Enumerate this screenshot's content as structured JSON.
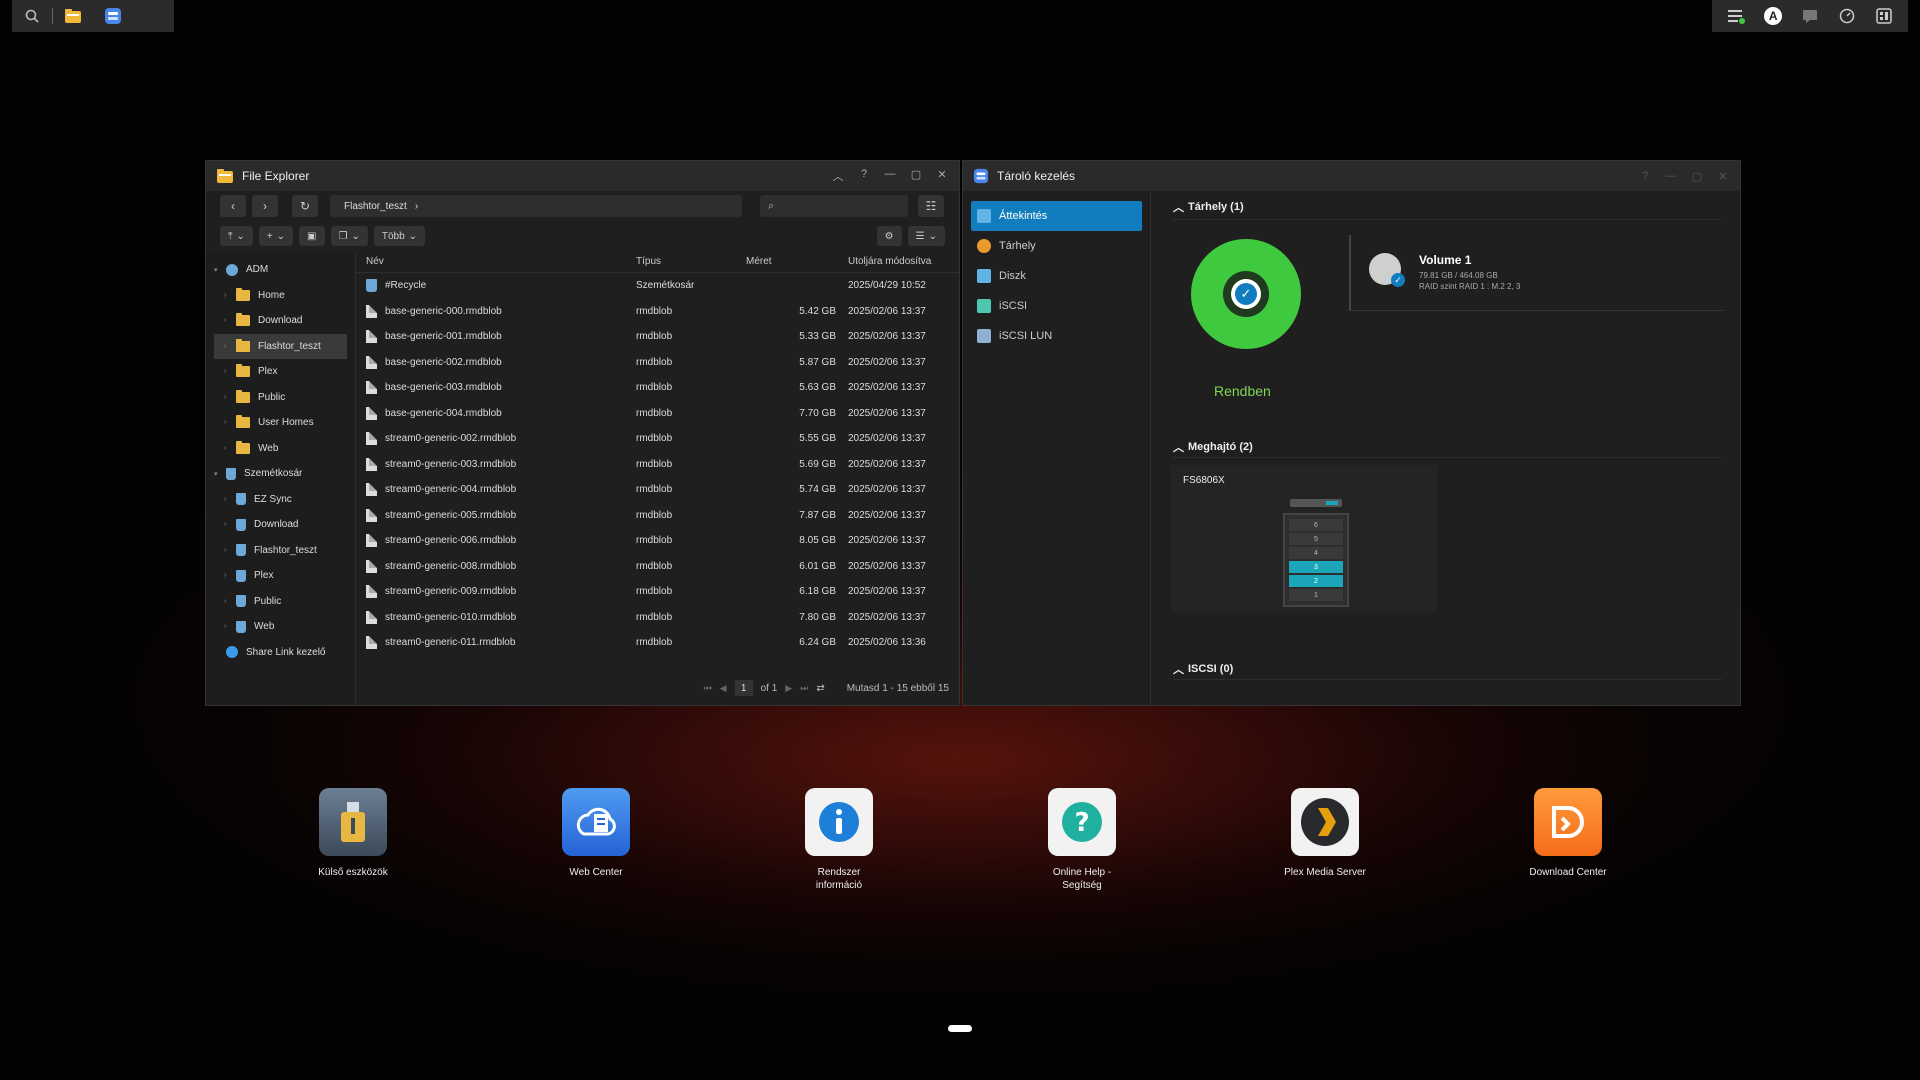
{
  "colors": {
    "accent": "#117dbe",
    "ok_green": "#3ec93e",
    "folder": "#e8b741",
    "bay_used": "#1aa6b8"
  },
  "file_explorer": {
    "title": "File Explorer",
    "path": "Flashtor_teszt",
    "more_label": "Több",
    "columns": {
      "name": "Név",
      "type": "Típus",
      "size": "Méret",
      "modified": "Utoljára módosítva"
    },
    "tree": [
      {
        "label": "ADM",
        "level": 0,
        "icon": "disk-icon"
      },
      {
        "label": "Home",
        "level": 1,
        "icon": "folder-icon"
      },
      {
        "label": "Download",
        "level": 1,
        "icon": "folder-icon"
      },
      {
        "label": "Flashtor_teszt",
        "level": 1,
        "icon": "folder-icon",
        "selected": true
      },
      {
        "label": "Plex",
        "level": 1,
        "icon": "folder-icon"
      },
      {
        "label": "Public",
        "level": 1,
        "icon": "folder-icon"
      },
      {
        "label": "User Homes",
        "level": 1,
        "icon": "folder-icon"
      },
      {
        "label": "Web",
        "level": 1,
        "icon": "folder-icon"
      },
      {
        "label": "Szemétkosár",
        "level": 0,
        "icon": "recycle-bin-icon"
      },
      {
        "label": "EZ Sync",
        "level": 1,
        "icon": "recycle-bin-icon"
      },
      {
        "label": "Download",
        "level": 1,
        "icon": "recycle-bin-icon"
      },
      {
        "label": "Flashtor_teszt",
        "level": 1,
        "icon": "recycle-bin-icon"
      },
      {
        "label": "Plex",
        "level": 1,
        "icon": "recycle-bin-icon"
      },
      {
        "label": "Public",
        "level": 1,
        "icon": "recycle-bin-icon"
      },
      {
        "label": "Web",
        "level": 1,
        "icon": "recycle-bin-icon"
      },
      {
        "label": "Share Link kezelő",
        "level": 0,
        "icon": "share-link-icon"
      }
    ],
    "files": [
      {
        "name": "#Recycle",
        "type": "Szemétkosár",
        "size": "",
        "modified": "2025/04/29 10:52"
      },
      {
        "name": "base-generic-000.rmdblob",
        "type": "rmdblob",
        "size": "5.42 GB",
        "modified": "2025/02/06 13:37"
      },
      {
        "name": "base-generic-001.rmdblob",
        "type": "rmdblob",
        "size": "5.33 GB",
        "modified": "2025/02/06 13:37"
      },
      {
        "name": "base-generic-002.rmdblob",
        "type": "rmdblob",
        "size": "5.87 GB",
        "modified": "2025/02/06 13:37"
      },
      {
        "name": "base-generic-003.rmdblob",
        "type": "rmdblob",
        "size": "5.63 GB",
        "modified": "2025/02/06 13:37"
      },
      {
        "name": "base-generic-004.rmdblob",
        "type": "rmdblob",
        "size": "7.70 GB",
        "modified": "2025/02/06 13:37"
      },
      {
        "name": "stream0-generic-002.rmdblob",
        "type": "rmdblob",
        "size": "5.55 GB",
        "modified": "2025/02/06 13:37"
      },
      {
        "name": "stream0-generic-003.rmdblob",
        "type": "rmdblob",
        "size": "5.69 GB",
        "modified": "2025/02/06 13:37"
      },
      {
        "name": "stream0-generic-004.rmdblob",
        "type": "rmdblob",
        "size": "5.74 GB",
        "modified": "2025/02/06 13:37"
      },
      {
        "name": "stream0-generic-005.rmdblob",
        "type": "rmdblob",
        "size": "7.87 GB",
        "modified": "2025/02/06 13:37"
      },
      {
        "name": "stream0-generic-006.rmdblob",
        "type": "rmdblob",
        "size": "8.05 GB",
        "modified": "2025/02/06 13:37"
      },
      {
        "name": "stream0-generic-008.rmdblob",
        "type": "rmdblob",
        "size": "6.01 GB",
        "modified": "2025/02/06 13:37"
      },
      {
        "name": "stream0-generic-009.rmdblob",
        "type": "rmdblob",
        "size": "6.18 GB",
        "modified": "2025/02/06 13:37"
      },
      {
        "name": "stream0-generic-010.rmdblob",
        "type": "rmdblob",
        "size": "7.80 GB",
        "modified": "2025/02/06 13:37"
      },
      {
        "name": "stream0-generic-011.rmdblob",
        "type": "rmdblob",
        "size": "6.24 GB",
        "modified": "2025/02/06 13:36"
      }
    ],
    "pager": {
      "page": "1",
      "of": "of 1",
      "summary": "Mutasd 1 - 15 ebből 15"
    }
  },
  "storage": {
    "title": "Tároló kezelés",
    "nav": [
      {
        "label": "Áttekintés",
        "active": true,
        "icon": "overview-icon",
        "color": "#5fb3e6"
      },
      {
        "label": "Tárhely",
        "active": false,
        "icon": "volume-icon",
        "color": "#e89a2c"
      },
      {
        "label": "Diszk",
        "active": false,
        "icon": "disk-icon",
        "color": "#5fb3e6"
      },
      {
        "label": "iSCSI",
        "active": false,
        "icon": "iscsi-icon",
        "color": "#4ec6b0"
      },
      {
        "label": "iSCSI LUN",
        "active": false,
        "icon": "iscsi-lun-icon",
        "color": "#8fb0d0"
      }
    ],
    "volume_section": "Tárhely (1)",
    "status": "Rendben",
    "volume": {
      "name": "Volume 1",
      "usage": "79.81 GB / 464.08 GB",
      "raid": "RAID szint RAID 1 : M.2 2, 3"
    },
    "drive_section": "Meghajtó (2)",
    "device": "FS6806X",
    "bays": [
      {
        "label": "6",
        "used": false
      },
      {
        "label": "5",
        "used": false
      },
      {
        "label": "4",
        "used": false
      },
      {
        "label": "3",
        "used": true
      },
      {
        "label": "2",
        "used": true
      },
      {
        "label": "1",
        "used": false
      }
    ],
    "iscsi_section": "ISCSI (0)"
  },
  "desktop": [
    {
      "label": "Külső eszközök",
      "icon": "external-devices-icon"
    },
    {
      "label": "Web Center",
      "icon": "web-center-icon"
    },
    {
      "label": "Rendszer információ",
      "icon": "system-info-icon"
    },
    {
      "label": "Online Help - Segítség",
      "icon": "online-help-icon"
    },
    {
      "label": "Plex Media Server",
      "icon": "plex-icon"
    },
    {
      "label": "Download Center",
      "icon": "download-center-icon"
    }
  ]
}
